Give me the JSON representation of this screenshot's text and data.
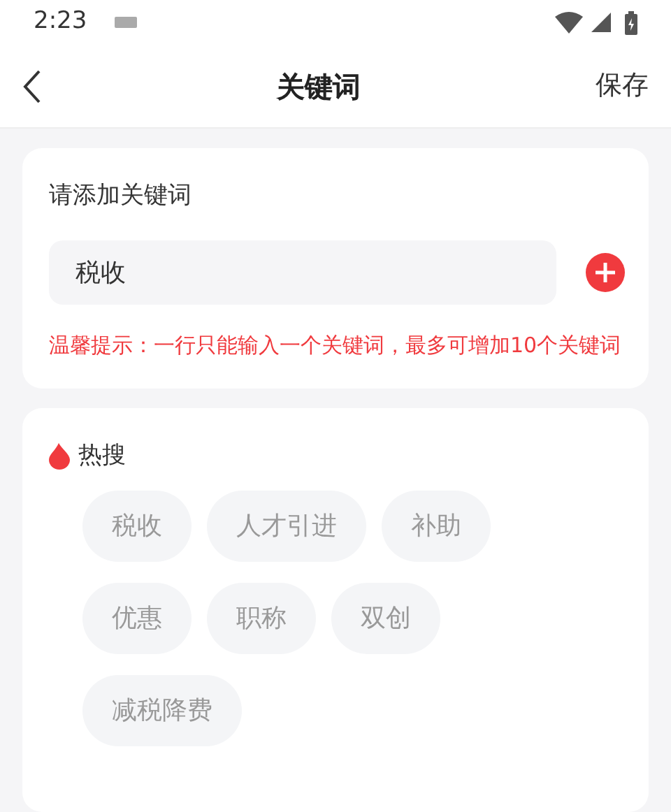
{
  "status_bar": {
    "time": "2:23"
  },
  "header": {
    "title": "关键词",
    "action": "保存"
  },
  "keyword_card": {
    "title": "请添加关键词",
    "input": {
      "value": "税收"
    },
    "tip": "温馨提示：一行只能输入一个关键词，最多可增加10个关键词"
  },
  "hot_search": {
    "title": "热搜",
    "tags": [
      "税收",
      "人才引进",
      "补助",
      "优惠",
      "职称",
      "双创",
      "减税降费"
    ]
  }
}
